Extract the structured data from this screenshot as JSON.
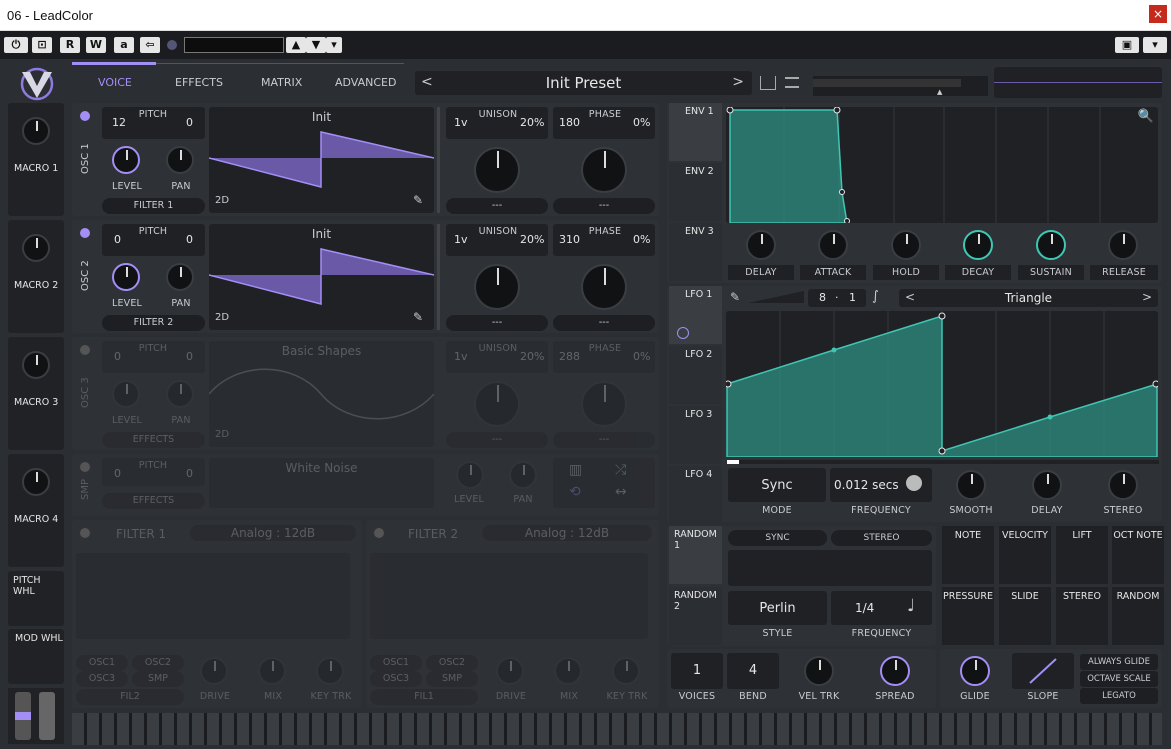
{
  "window": {
    "title": "06 - LeadColor",
    "close": "×"
  },
  "toolbar": {
    "r": "R",
    "w": "W",
    "a": "a",
    "back": "⇦",
    "dd": "▾",
    "cam": "▣"
  },
  "tabs": [
    "VOICE",
    "EFFECTS",
    "MATRIX",
    "ADVANCED"
  ],
  "preset": {
    "name": "Init Preset",
    "prev": "<",
    "next": ">"
  },
  "macros": [
    "MACRO 1",
    "MACRO 2",
    "MACRO 3",
    "MACRO 4",
    "PITCH WHL",
    "MOD WHL"
  ],
  "osc1": {
    "label": "OSC 1",
    "pitch": "PITCH",
    "pitch_l": "12",
    "pitch_r": "0",
    "wave": "Init",
    "dim": "2D",
    "level": "LEVEL",
    "pan": "PAN",
    "filter": "FILTER 1",
    "unison": "UNISON",
    "uni_l": "1v",
    "uni_r": "20%",
    "phase": "PHASE",
    "ph_l": "180",
    "ph_r": "0%",
    "sel": "---"
  },
  "osc2": {
    "label": "OSC 2",
    "pitch": "PITCH",
    "pitch_l": "0",
    "pitch_r": "0",
    "wave": "Init",
    "dim": "2D",
    "level": "LEVEL",
    "pan": "PAN",
    "filter": "FILTER 2",
    "unison": "UNISON",
    "uni_l": "1v",
    "uni_r": "20%",
    "phase": "PHASE",
    "ph_l": "310",
    "ph_r": "0%",
    "sel": "---"
  },
  "osc3": {
    "label": "OSC 3",
    "pitch": "PITCH",
    "pitch_l": "0",
    "pitch_r": "0",
    "wave": "Basic Shapes",
    "dim": "2D",
    "level": "LEVEL",
    "pan": "PAN",
    "filter": "EFFECTS",
    "unison": "UNISON",
    "uni_l": "1v",
    "uni_r": "20%",
    "phase": "PHASE",
    "ph_l": "288",
    "ph_r": "0%",
    "sel": "---"
  },
  "smp": {
    "label": "SMP",
    "pitch": "PITCH",
    "pitch_l": "0",
    "pitch_r": "0",
    "wave": "White Noise",
    "filter": "EFFECTS",
    "level": "LEVEL",
    "pan": "PAN"
  },
  "filter1": {
    "label": "FILTER 1",
    "type": "Analog : 12dB",
    "src": [
      "OSC1",
      "OSC2",
      "OSC3",
      "SMP"
    ],
    "fil": "FIL2",
    "drive": "DRIVE",
    "mix": "MIX",
    "key": "KEY TRK"
  },
  "filter2": {
    "label": "FILTER 2",
    "type": "Analog : 12dB",
    "src": [
      "OSC1",
      "OSC2",
      "OSC3",
      "SMP"
    ],
    "fil": "FIL1",
    "drive": "DRIVE",
    "mix": "MIX",
    "key": "KEY TRK"
  },
  "env": {
    "tabs": [
      "ENV 1",
      "ENV 2",
      "ENV 3"
    ],
    "knobs": [
      "DELAY",
      "ATTACK",
      "HOLD",
      "DECAY",
      "SUSTAIN",
      "RELEASE"
    ]
  },
  "lfo": {
    "tabs": [
      "LFO 1",
      "LFO 2",
      "LFO 3",
      "LFO 4"
    ],
    "rate_l": "8",
    "rate_sep": "·",
    "rate_r": "1",
    "shape": "Triangle",
    "mode_val": "Sync",
    "mode": "MODE",
    "freq_val": "0.012 secs",
    "freq": "FREQUENCY",
    "smooth": "SMOOTH",
    "delay": "DELAY",
    "stereo": "STEREO"
  },
  "random": {
    "tabs": [
      "RANDOM 1",
      "RANDOM 2"
    ],
    "sync": "SYNC",
    "stereo": "STEREO",
    "style_val": "Perlin",
    "style": "STYLE",
    "freq_val": "1/4",
    "freq": "FREQUENCY"
  },
  "mods": [
    "NOTE",
    "VELOCITY",
    "LIFT",
    "OCT NOTE",
    "PRESSURE",
    "SLIDE",
    "STEREO",
    "RANDOM"
  ],
  "voice": {
    "voices_val": "1",
    "voices": "VOICES",
    "bend_val": "4",
    "bend": "BEND",
    "vel": "VEL TRK",
    "spread": "SPREAD",
    "glide": "GLIDE",
    "slope": "SLOPE",
    "opts": [
      "ALWAYS GLIDE",
      "OCTAVE SCALE",
      "LEGATO"
    ]
  },
  "colors": {
    "accent": "#a38ef5",
    "teal": "#3fc7b4"
  }
}
